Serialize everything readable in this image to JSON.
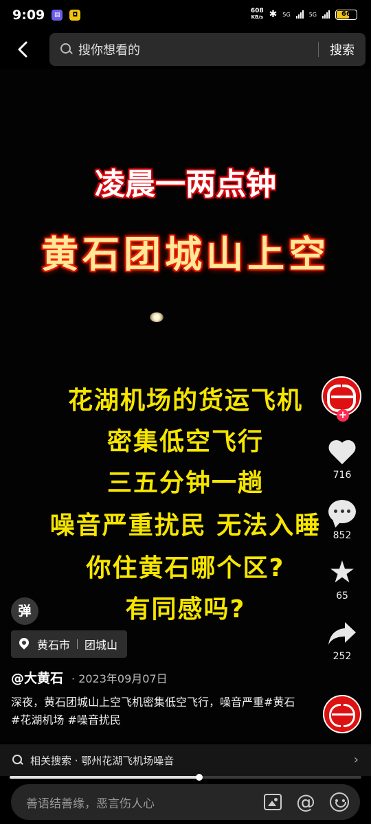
{
  "status_bar": {
    "time": "9:09",
    "net_speed_value": "608",
    "net_speed_unit": "KB/s",
    "signal_1": "5G",
    "signal_2": "5G",
    "battery": "66"
  },
  "search": {
    "placeholder": "搜你想看的",
    "button_label": "搜索"
  },
  "video": {
    "headline_1": "凌晨一两点钟",
    "headline_2": "黄石团城山上空",
    "caption_lines": [
      "花湖机场的货运飞机",
      "密集低空飞行",
      "三五分钟一趟",
      "噪音严重扰民 无法入睡",
      "你住黄石哪个区?",
      "有同感吗?"
    ]
  },
  "actions": {
    "like_count": "716",
    "comment_count": "852",
    "favorite_count": "65",
    "share_count": "252",
    "follow_symbol": "+"
  },
  "danmu_label": "弹",
  "location": {
    "city": "黄石市",
    "place": "团城山"
  },
  "post": {
    "author": "@大黄石",
    "date": "· 2023年09月07日",
    "description": "深夜，黄石团城山上空飞机密集低空飞行，噪音严重#黄石 #花湖机场 #噪音扰民"
  },
  "related_search": {
    "label": "相关搜索 · 鄂州花湖飞机场噪音"
  },
  "progress": {
    "fraction": 0.54
  },
  "comment_input": {
    "placeholder": "善语结善缘，恶言伤人心",
    "at_symbol": "@"
  },
  "colors": {
    "caption": "#f6e500",
    "headline_glow": "#e0101a",
    "avatar_bg": "#dd1111",
    "follow_badge": "#fe2c55"
  }
}
